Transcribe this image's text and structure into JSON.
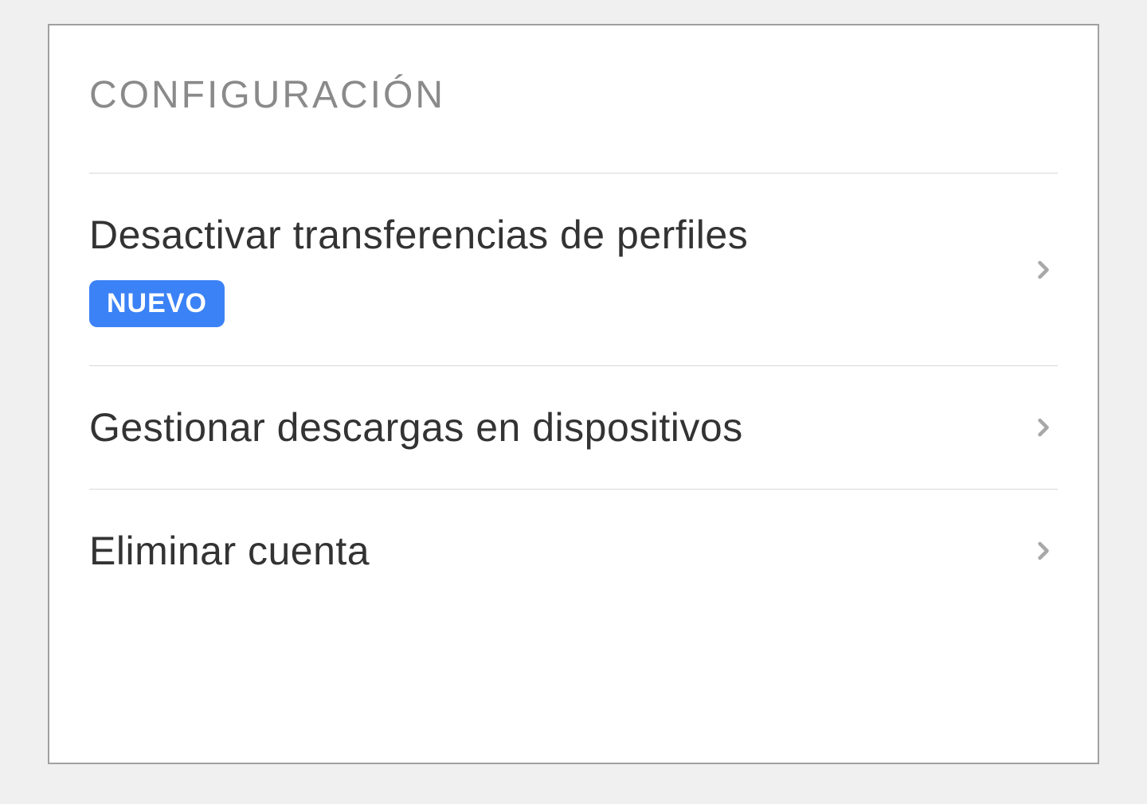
{
  "section": {
    "title": "Configuración"
  },
  "items": [
    {
      "label": "Desactivar transferencias de perfiles",
      "badge": "NUEVO"
    },
    {
      "label": "Gestionar descargas en dispositivos"
    },
    {
      "label": "Eliminar cuenta"
    }
  ]
}
